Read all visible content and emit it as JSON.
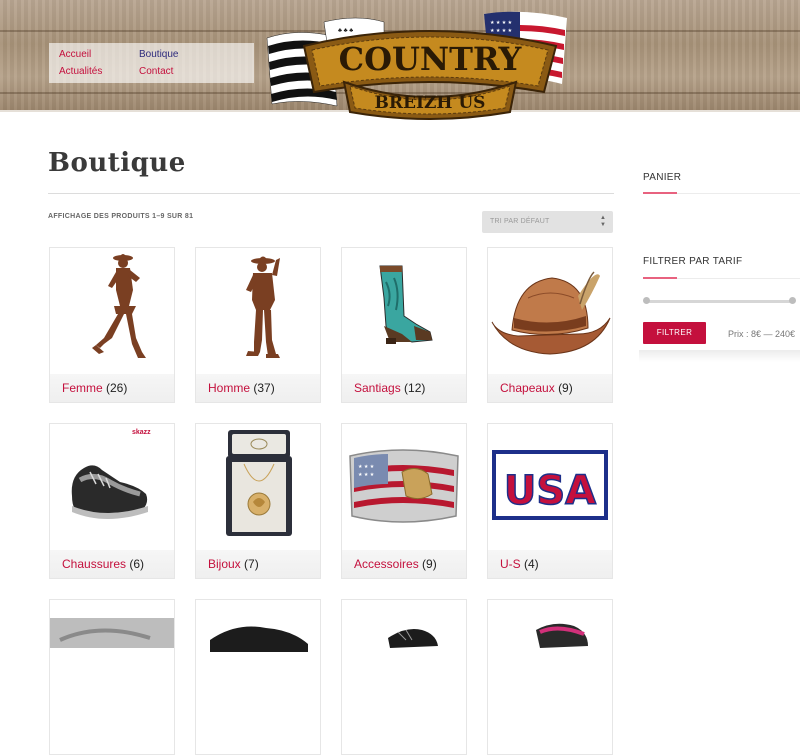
{
  "header": {
    "nav": [
      {
        "label": "Accueil",
        "active": false
      },
      {
        "label": "Actualités",
        "active": false
      },
      {
        "label": "Boutique",
        "active": true
      },
      {
        "label": "Contact",
        "active": false
      }
    ],
    "logo": {
      "line1": "COUNTRY",
      "line2": "BREIZH US"
    }
  },
  "main": {
    "title": "Boutique",
    "result_count": "AFFICHAGE DES PRODUITS 1–9 SUR 81",
    "ordering": {
      "selected": "TRI PAR DÉFAUT"
    },
    "categories": [
      {
        "name": "Femme",
        "count": "(26)",
        "icon": "cowgirl-silhouette"
      },
      {
        "name": "Homme",
        "count": "(37)",
        "icon": "cowboy-silhouette"
      },
      {
        "name": "Santiags",
        "count": "(12)",
        "icon": "cowboy-boot"
      },
      {
        "name": "Chapeaux",
        "count": "(9)",
        "icon": "cowboy-hat"
      },
      {
        "name": "Chaussures",
        "count": "(6)",
        "icon": "dance-sneaker",
        "brand": "skazz"
      },
      {
        "name": "Bijoux",
        "count": "(7)",
        "icon": "pendant-necklace"
      },
      {
        "name": "Accessoires",
        "count": "(9)",
        "icon": "flag-belt-buckle"
      },
      {
        "name": "U-S",
        "count": "(4)",
        "icon": "usa-towel",
        "text": "USA"
      }
    ]
  },
  "sidebar": {
    "cart_title": "PANIER",
    "filter_title": "FILTRER PAR TARIF",
    "filter_button": "FILTRER",
    "price_label": "Prix : 8€ — 240€",
    "price_min": 8,
    "price_max": 240
  },
  "colors": {
    "accent": "#c4103d",
    "nav_active": "#2d2a7c",
    "widget_accent": "#e8627f"
  }
}
